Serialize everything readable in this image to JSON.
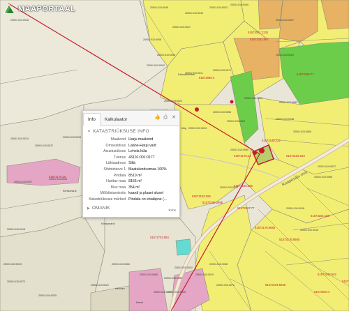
{
  "app": {
    "logo_text": "MAAPORTAAL"
  },
  "colors": {
    "yellow": "#f2ee74",
    "green": "#6ccd4b",
    "pink": "#e4a6c4",
    "orange": "#e7b264",
    "cyan": "#62dcd2",
    "boundary": "#c41d2a"
  },
  "map_labels": [
    "20001:010:0010",
    "20001:010:0016",
    "20001:010:0045",
    "20001:010:0033",
    "20001:010:0043",
    "20001:010:0040",
    "51573001:1234",
    "51573242:467",
    "20001:010:0037",
    "20001:010:0119",
    "20001:010:0006",
    "20001:010:0047",
    "20001:010:0054",
    "51573169:77",
    "20001:010:0042",
    "20001:010:0011",
    "20001:010:0071",
    "Rahuvalimetsa",
    "51573085:3",
    "20001:010:0022",
    "20001:010:0055",
    "20001:010:0063",
    "20001:010:0083",
    "20001:010:0064",
    "20001:010:0044",
    "20001:010:0005",
    "20001:010:0074",
    "20001:010:0072",
    "20001:010:0034",
    "20001:010:0024",
    "51573169:222",
    "20001:010:0048",
    "51573164:184",
    "Mäe",
    "Müg",
    "20001:010:0060",
    "51573178:24",
    "20001:010:0060",
    "20001:010:0003",
    "20001:010:0007",
    "Kõrtsumardi",
    "51573176:25",
    "51573193:265",
    "51573192:2695",
    "51573193:266",
    "Raapesalu mnt",
    "20001:010:0065",
    "20001:010:0037",
    "20001:010:0020",
    "51573167:77",
    "20001:010:0018",
    "51573164:186",
    "51573176:8666",
    "20001:010:0018",
    "51573176:8665",
    "51573168:562",
    "51573164:5536",
    "51573040:4",
    "51573175:54",
    "51571701:954",
    "Kõrtsumardi",
    "20001:010:0065",
    "20001:010:0063",
    "20001:010:0035",
    "Hendren",
    "Kemsi",
    "20001:010:0018",
    "20001:010:0019",
    "20001:010:0073",
    "20001:010:0025",
    "20001:010:0021",
    "20001:010:0080",
    "20001:010:0080",
    "20001:010:0017",
    "20001:010:0002",
    "20001:010:0068",
    "20001:010:0019",
    "20001:010:0072"
  ],
  "panel": {
    "tabs": [
      "Info",
      "Kalkulaator"
    ],
    "section_title": "KATASTRIÜKSUSE INFO",
    "rows": [
      {
        "key": "Maakond",
        "value": "Harju maakond"
      },
      {
        "key": "Omavalitsus",
        "value": "Lääne-Harju vald"
      },
      {
        "key": "Asustusüksus",
        "value": "Lehola küla"
      },
      {
        "key": "Tunnus",
        "value": "43101:001:0177"
      },
      {
        "key": "Lähiaadress",
        "value": "Siliä"
      },
      {
        "key": "Sihtotstarve 1",
        "value": "Maatulundusmaa 100%"
      },
      {
        "key": "Pindala",
        "value": "8510 m²"
      },
      {
        "key": "Haritav maa",
        "value": "8156 m²"
      },
      {
        "key": "Muu maa",
        "value": "354 m²"
      },
      {
        "key": "Mõõdistamisviis",
        "value": "kaardi ja plaani alusel"
      },
      {
        "key": "Katastriüksuse märked",
        "value": "Pindala on ebatäpne (..."
      }
    ],
    "owner_title": "OMANIK",
    "more_label": "Rohk"
  }
}
